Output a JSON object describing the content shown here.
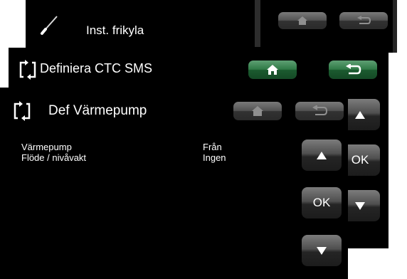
{
  "screens": {
    "inst_frikyla": {
      "title": "Inst. frikyla",
      "icon": "screwdriver-icon"
    },
    "definiera_ctc_sms": {
      "title": "Definiera CTC SMS",
      "icon": "cycle-arrows-icon"
    },
    "def_varmepump": {
      "title": "Def Värmepump",
      "icon": "cycle-arrows-icon",
      "rows": [
        {
          "label": "Värmepump",
          "value": "Från"
        },
        {
          "label": "Flöde / nivåvakt",
          "value": "Ingen"
        }
      ],
      "buttons": {
        "ok_label": "OK"
      }
    },
    "side_buttons": {
      "ok_label": "OK"
    }
  },
  "colors": {
    "background": "#000000",
    "text": "#ffffff",
    "active_nav": "#2f7a46",
    "inactive_nav": "#535353"
  }
}
